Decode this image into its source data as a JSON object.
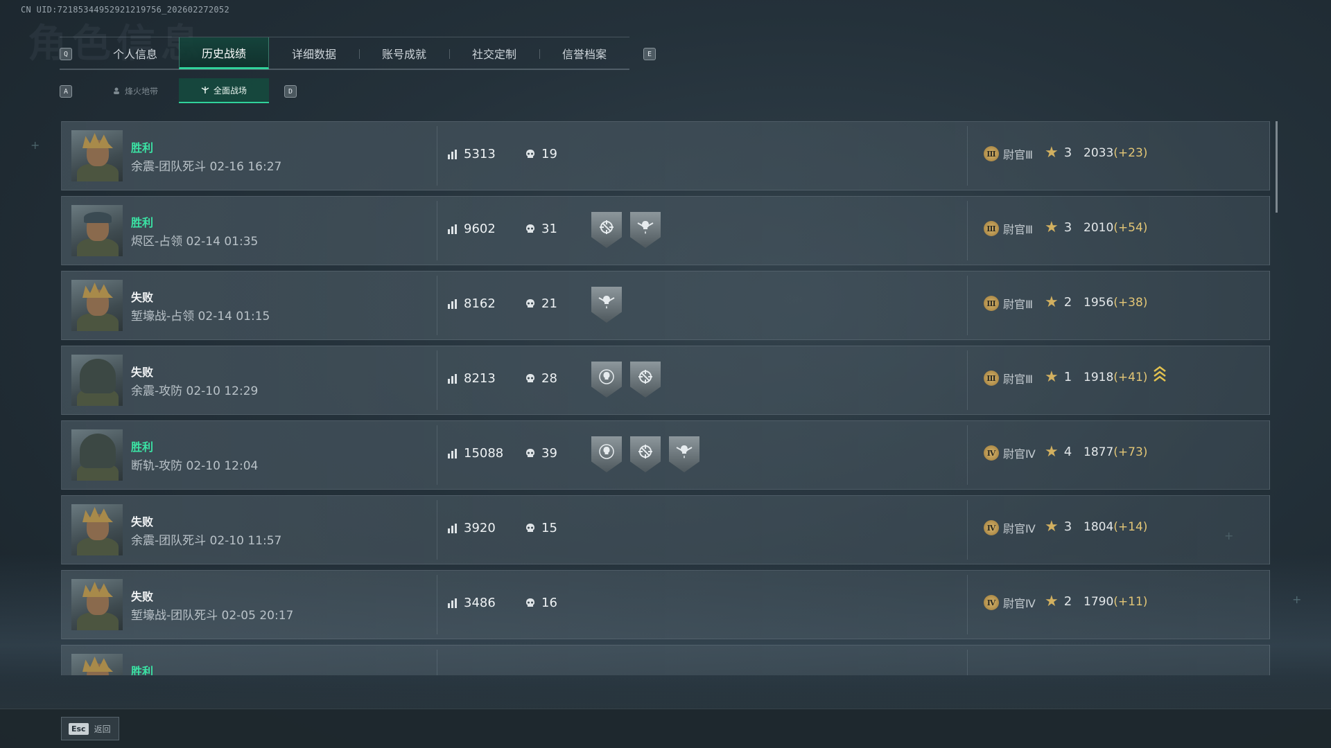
{
  "uid_text": "CN UID:72185344952921219756_202602272052",
  "ghost_title": "角色信息",
  "tabs": {
    "left_key": "Q",
    "right_key": "E",
    "items": [
      {
        "label": "个人信息",
        "active": false
      },
      {
        "label": "历史战绩",
        "active": true
      },
      {
        "label": "详细数据",
        "active": false
      },
      {
        "label": "账号成就",
        "active": false
      },
      {
        "label": "社交定制",
        "active": false
      },
      {
        "label": "信誉档案",
        "active": false
      }
    ]
  },
  "subtabs": {
    "left_key": "A",
    "right_key": "D",
    "items": [
      {
        "label": "烽火地带",
        "icon": "operator-icon",
        "active": false
      },
      {
        "label": "全面战场",
        "icon": "battlefield-icon",
        "active": true
      }
    ]
  },
  "colors": {
    "win": "#3be3a4",
    "accent": "#31d39b",
    "delta": "#e3c676",
    "rank_gold": "#d8b56c"
  },
  "matches": [
    {
      "result": "胜利",
      "win": true,
      "portrait": "crown",
      "mode": "余震-团队死斗 02-16 16:27",
      "score": "5313",
      "kills": "19",
      "medals": [],
      "rank_numeral": "Ⅲ",
      "rank": "尉官Ⅲ",
      "stars": "3",
      "elo": "2033",
      "delta": "(+23)",
      "promotion": false
    },
    {
      "result": "胜利",
      "win": true,
      "portrait": "cap",
      "mode": "烬区-占领 02-14 01:35",
      "score": "9602",
      "kills": "31",
      "medals": [
        "crosshair-medal-icon",
        "skull-wings-medal-icon"
      ],
      "rank_numeral": "Ⅲ",
      "rank": "尉官Ⅲ",
      "stars": "3",
      "elo": "2010",
      "delta": "(+54)",
      "promotion": false
    },
    {
      "result": "失败",
      "win": false,
      "portrait": "crown",
      "mode": "堑壕战-占领 02-14 01:15",
      "score": "8162",
      "kills": "21",
      "medals": [
        "skull-wings-medal-icon"
      ],
      "rank_numeral": "Ⅲ",
      "rank": "尉官Ⅲ",
      "stars": "2",
      "elo": "1956",
      "delta": "(+38)",
      "promotion": false
    },
    {
      "result": "失败",
      "win": false,
      "portrait": "hood",
      "mode": "余震-攻防 02-10 12:29",
      "score": "8213",
      "kills": "28",
      "medals": [
        "skull-target-medal-icon",
        "crosshair-medal-icon"
      ],
      "rank_numeral": "Ⅲ",
      "rank": "尉官Ⅲ",
      "stars": "1",
      "elo": "1918",
      "delta": "(+41)",
      "promotion": true
    },
    {
      "result": "胜利",
      "win": true,
      "portrait": "hood",
      "mode": "断轨-攻防 02-10 12:04",
      "score": "15088",
      "kills": "39",
      "medals": [
        "skull-target-medal-icon",
        "crosshair-medal-icon",
        "skull-wings-medal-icon"
      ],
      "rank_numeral": "Ⅳ",
      "rank": "尉官Ⅳ",
      "stars": "4",
      "elo": "1877",
      "delta": "(+73)",
      "promotion": false
    },
    {
      "result": "失败",
      "win": false,
      "portrait": "crown",
      "mode": "余震-团队死斗 02-10 11:57",
      "score": "3920",
      "kills": "15",
      "medals": [],
      "rank_numeral": "Ⅳ",
      "rank": "尉官Ⅳ",
      "stars": "3",
      "elo": "1804",
      "delta": "(+14)",
      "promotion": false
    },
    {
      "result": "失败",
      "win": false,
      "portrait": "crown",
      "mode": "堑壕战-团队死斗 02-05 20:17",
      "score": "3486",
      "kills": "16",
      "medals": [],
      "rank_numeral": "Ⅳ",
      "rank": "尉官Ⅳ",
      "stars": "2",
      "elo": "1790",
      "delta": "(+11)",
      "promotion": false
    },
    {
      "result": "胜利",
      "win": true,
      "portrait": "crown",
      "mode": "",
      "score": "",
      "kills": "",
      "medals": [],
      "rank_numeral": "",
      "rank": "",
      "stars": "",
      "elo": "",
      "delta": "",
      "promotion": false
    }
  ],
  "footer": {
    "esc_key": "Esc",
    "back_label": "返回"
  }
}
